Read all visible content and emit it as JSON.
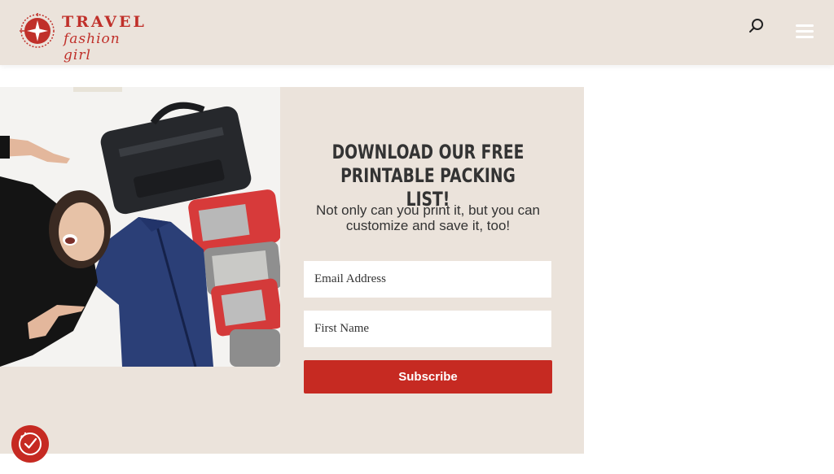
{
  "header": {
    "logo": {
      "word_top": "TRAVEL",
      "word_bottom": "fashion girl"
    },
    "search_icon": "search-icon",
    "menu_icon": "hamburger-menu-icon"
  },
  "promo": {
    "title": "DOWNLOAD OUR FREE PRINTABLE PACKING LIST!",
    "subtitle": "Not only can you print it, but you can customize and save it, too!",
    "email_placeholder": "Email Address",
    "first_name_placeholder": "First Name",
    "subscribe_label": "Subscribe"
  },
  "floating_badge": {
    "icon": "privacy-check-icon"
  },
  "colors": {
    "header_bg": "#ebe3db",
    "promo_bg": "#ebe3db",
    "brand_red": "#c62a22",
    "text": "#333333"
  }
}
